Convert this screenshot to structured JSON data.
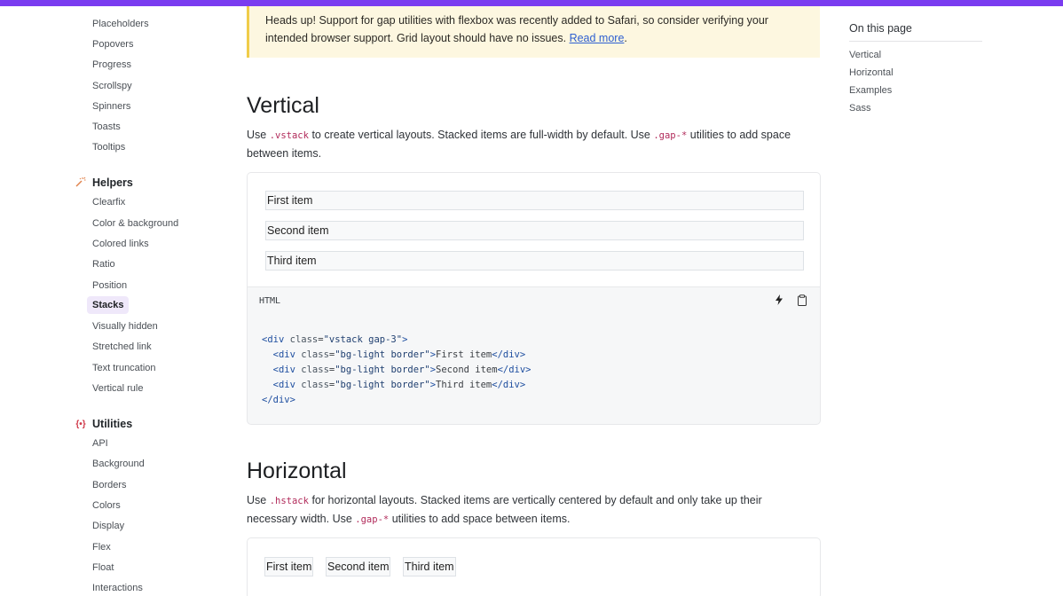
{
  "sidebar": {
    "components_tail": [
      "Placeholders",
      "Popovers",
      "Progress",
      "Scrollspy",
      "Spinners",
      "Toasts",
      "Tooltips"
    ],
    "helpers": {
      "label": "Helpers",
      "items": [
        "Clearfix",
        "Color & background",
        "Colored links",
        "Ratio",
        "Position",
        "Stacks",
        "Visually hidden",
        "Stretched link",
        "Text truncation",
        "Vertical rule"
      ],
      "active": "Stacks"
    },
    "utilities": {
      "label": "Utilities",
      "icon": "{•}",
      "items": [
        "API",
        "Background",
        "Borders",
        "Colors",
        "Display",
        "Flex",
        "Float",
        "Interactions"
      ]
    }
  },
  "alert": {
    "text": "Heads up! Support for gap utilities with flexbox was recently added to Safari, so consider verifying your intended browser support. Grid layout should have no issues.",
    "link": "Read more"
  },
  "vertical": {
    "heading": "Vertical",
    "desc": {
      "p1": "Use ",
      "code1": ".vstack",
      "p2": " to create vertical layouts. Stacked items are full-width by default. Use ",
      "code2": ".gap-*",
      "p3": " utilities to add space between items."
    },
    "items": [
      "First item",
      "Second item",
      "Third item"
    ],
    "code_lang": "HTML",
    "code": {
      "outer_class": "vstack gap-3",
      "item_class": "bg-light border",
      "items": [
        "First item",
        "Second item",
        "Third item"
      ]
    }
  },
  "horizontal": {
    "heading": "Horizontal",
    "desc": {
      "p1": "Use ",
      "code1": ".hstack",
      "p2": " for horizontal layouts. Stacked items are vertically centered by default and only take up their necessary width. Use ",
      "code2": ".gap-*",
      "p3": " utilities to add space between items."
    },
    "items": [
      "First item",
      "Second item",
      "Third item"
    ]
  },
  "toc": {
    "title": "On this page",
    "items": [
      "Vertical",
      "Horizontal",
      "Examples",
      "Sass"
    ]
  },
  "colors": {
    "accent": "#7a3cf0",
    "active_bg": "#efe8fa",
    "alert_bg": "#fdf7e0",
    "alert_border": "#f0cc4a",
    "code_inline": "#b12a5a",
    "link": "#2d5fd0"
  }
}
